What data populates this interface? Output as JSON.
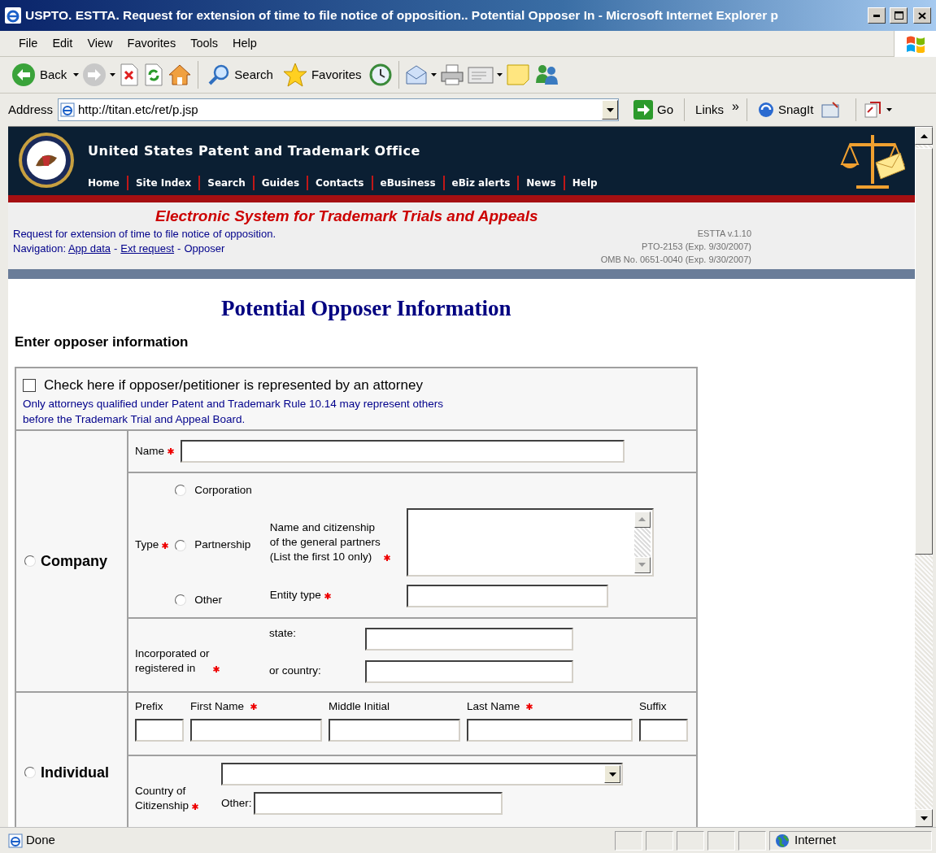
{
  "window": {
    "title": "USPTO. ESTTA. Request for extension of time to file notice of opposition.. Potential Opposer In - Microsoft Internet Explorer p"
  },
  "menu": [
    "File",
    "Edit",
    "View",
    "Favorites",
    "Tools",
    "Help"
  ],
  "toolbar": {
    "back": "Back",
    "search": "Search",
    "favorites": "Favorites"
  },
  "address_bar": {
    "label": "Address",
    "url": "http://titan.etc/ret/p.jsp",
    "go": "Go",
    "links": "Links",
    "links_more": "»",
    "snagit": "SnagIt"
  },
  "site": {
    "title": "United States Patent and Trademark Office",
    "nav": [
      "Home",
      "Site Index",
      "Search",
      "Guides",
      "Contacts",
      "eBusiness",
      "eBiz alerts",
      "News",
      "Help"
    ]
  },
  "estta": {
    "title": "Electronic System for Trademark Trials and Appeals",
    "description": "Request for extension of time to file notice of opposition.",
    "navigation_label": "Navigation:",
    "breadcrumbs": [
      {
        "label": "App data",
        "link": true
      },
      {
        "label": "Ext request",
        "link": true
      },
      {
        "label": "Opposer",
        "link": false
      }
    ],
    "breadcrumb_separators": [
      "-",
      "-"
    ],
    "version_lines": [
      "ESTTA v.1.10",
      "PTO-2153 (Exp. 9/30/2007)",
      "OMB No. 0651-0040 (Exp. 9/30/2007)"
    ]
  },
  "heading": "Potential Opposer Information",
  "subheading": "Enter opposer information",
  "attorney": {
    "label": "Check here if opposer/petitioner is represented by an attorney",
    "checked": false,
    "note_lines": [
      "Only attorneys qualified under Patent and Trademark Rule 10.14 may represent others",
      "before the Trademark Trial and Appeal Board."
    ]
  },
  "company": {
    "label": "Company",
    "selected": false,
    "name_label": "Name",
    "type_label": "Type",
    "types": [
      {
        "label": "Corporation",
        "selected": false
      },
      {
        "label": "Partnership",
        "selected": false
      },
      {
        "label": "Other",
        "selected": false
      }
    ],
    "partners_label_lines": [
      "Name and citizenship",
      "of the general partners",
      "(List the first 10 only)"
    ],
    "entity_type_label": "Entity type",
    "incorporated_label_lines": [
      "Incorporated or",
      "registered in"
    ],
    "state_label": "state:",
    "country_label": "or country:"
  },
  "individual": {
    "label": "Individual",
    "selected": false,
    "name_fields": [
      {
        "label": "Prefix",
        "required": false
      },
      {
        "label": "First Name",
        "required": true
      },
      {
        "label": "Middle Initial",
        "required": false
      },
      {
        "label": "Last Name",
        "required": true
      },
      {
        "label": "Suffix",
        "required": false
      }
    ],
    "citizenship_label_lines": [
      "Country of",
      "Citizenship"
    ],
    "other_label": "Other:"
  },
  "status_bar": {
    "text": "Done",
    "zone": "Internet"
  }
}
